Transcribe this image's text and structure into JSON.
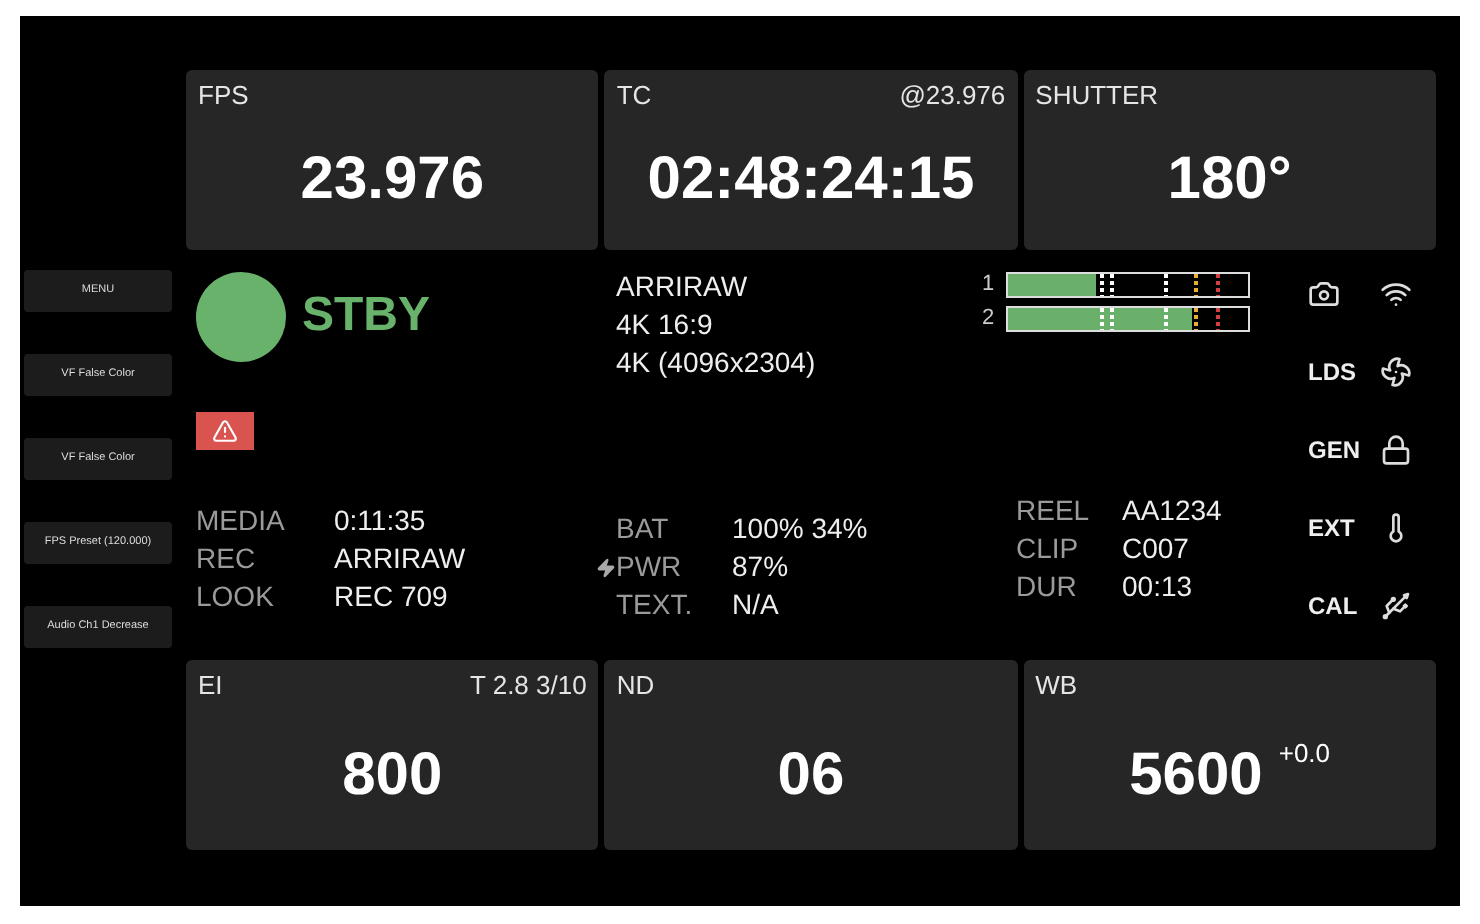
{
  "side_buttons": [
    {
      "label": "MENU"
    },
    {
      "label": "VF False Color"
    },
    {
      "label": "VF False Color"
    },
    {
      "label": "FPS Preset (120.000)"
    },
    {
      "label": "Audio Ch1 Decrease"
    }
  ],
  "top_tiles": [
    {
      "label": "FPS",
      "value": "23.976"
    },
    {
      "label": "TC",
      "note": "@23.976",
      "value": "02:48:24:15"
    },
    {
      "label": "SHUTTER",
      "value": "180°"
    }
  ],
  "status": {
    "text": "STBY",
    "color": "#69b26c"
  },
  "format": [
    "ARRIRAW",
    "4K 16:9",
    "4K (4096x2304)"
  ],
  "media_info": [
    {
      "label": "MEDIA",
      "value": "0:11:35"
    },
    {
      "label": "REC",
      "value": "ARRIRAW"
    },
    {
      "label": "LOOK",
      "value": "REC 709"
    }
  ],
  "power_info": [
    {
      "label": "BAT",
      "value": "100% 34%",
      "kind": "plain"
    },
    {
      "label": "PWR",
      "value": "87%",
      "kind": "power"
    },
    {
      "label": "TEXT.",
      "value": "N/A",
      "kind": "plain"
    }
  ],
  "audio_meters": [
    {
      "label": "1",
      "level": 0.37
    },
    {
      "label": "2",
      "level": 0.77
    }
  ],
  "clip_info": [
    {
      "label": "REEL",
      "value": "AA1234"
    },
    {
      "label": "CLIP",
      "value": "C007"
    },
    {
      "label": "DUR",
      "value": "00:13"
    }
  ],
  "indicators": [
    {
      "label": "LDS"
    },
    {
      "label": "GEN"
    },
    {
      "label": "EXT"
    },
    {
      "label": "CAL"
    }
  ],
  "bottom_tiles": [
    {
      "label": "EI",
      "note": "T 2.8 3/10",
      "value": "800"
    },
    {
      "label": "ND",
      "value": "06"
    },
    {
      "label": "WB",
      "value": "5600",
      "suffix": "+0.0"
    }
  ]
}
